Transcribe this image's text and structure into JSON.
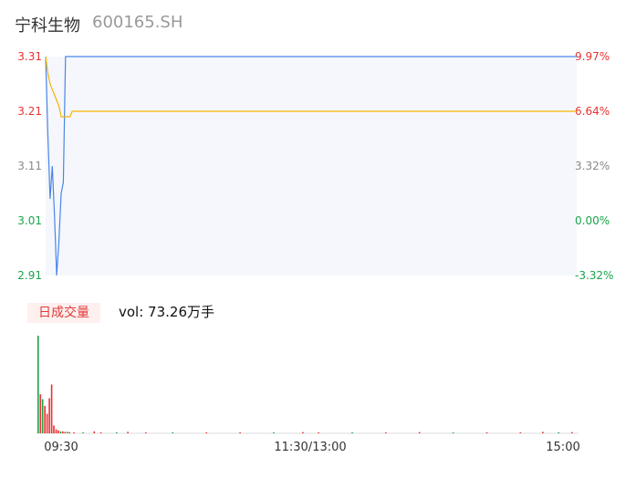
{
  "header": {
    "name": "宁科生物",
    "code": "600165.SH"
  },
  "volume": {
    "tab_label": "日成交量",
    "vol_text": "vol: 73.26万手"
  },
  "colors": {
    "up": "#e83232",
    "down": "#1aa34a",
    "neutral": "#888888",
    "price_line": "#4a86e8",
    "avg_line": "#f5b400",
    "plot_bg": "#f5f7fc"
  },
  "chart_data": {
    "type": "line",
    "title": "",
    "y_left_ticks": [
      "3.31",
      "3.21",
      "3.11",
      "3.01",
      "2.91"
    ],
    "y_right_ticks": [
      "9.97%",
      "6.64%",
      "3.32%",
      "0.00%",
      "-3.32%"
    ],
    "x_ticks": [
      "09:30",
      "11:30/13:00",
      "15:00"
    ],
    "ylim": [
      2.91,
      3.31
    ],
    "prev_close": 3.01,
    "total_minutes": 240,
    "series": [
      {
        "key": "price",
        "points": [
          [
            0,
            3.31
          ],
          [
            1,
            3.17
          ],
          [
            2,
            3.05
          ],
          [
            3,
            3.11
          ],
          [
            4,
            3.02
          ],
          [
            5,
            2.91
          ],
          [
            6,
            2.97
          ],
          [
            7,
            3.06
          ],
          [
            8,
            3.08
          ],
          [
            9,
            3.31
          ],
          [
            240,
            3.31
          ]
        ]
      },
      {
        "key": "avg",
        "points": [
          [
            0,
            3.31
          ],
          [
            1,
            3.28
          ],
          [
            2,
            3.26
          ],
          [
            3,
            3.25
          ],
          [
            4,
            3.24
          ],
          [
            5,
            3.23
          ],
          [
            6,
            3.22
          ],
          [
            7,
            3.2
          ],
          [
            8,
            3.2
          ],
          [
            10,
            3.2
          ],
          [
            11,
            3.2
          ],
          [
            12,
            3.21
          ],
          [
            240,
            3.21
          ]
        ]
      }
    ],
    "volume_bars": [
      {
        "t": 0,
        "v": 1.0,
        "c": "down"
      },
      {
        "t": 1,
        "v": 0.4,
        "c": "up"
      },
      {
        "t": 2,
        "v": 0.35,
        "c": "down"
      },
      {
        "t": 3,
        "v": 0.28,
        "c": "up"
      },
      {
        "t": 4,
        "v": 0.2,
        "c": "up"
      },
      {
        "t": 5,
        "v": 0.36,
        "c": "up"
      },
      {
        "t": 6,
        "v": 0.5,
        "c": "up"
      },
      {
        "t": 7,
        "v": 0.08,
        "c": "up"
      },
      {
        "t": 8,
        "v": 0.04,
        "c": "up"
      },
      {
        "t": 9,
        "v": 0.03,
        "c": "up"
      },
      {
        "t": 10,
        "v": 0.02,
        "c": "down"
      },
      {
        "t": 11,
        "v": 0.02,
        "c": "up"
      },
      {
        "t": 12,
        "v": 0.015,
        "c": "up"
      },
      {
        "t": 13,
        "v": 0.015,
        "c": "down"
      },
      {
        "t": 14,
        "v": 0.012,
        "c": "up"
      },
      {
        "t": 16,
        "v": 0.01,
        "c": "up"
      },
      {
        "t": 20,
        "v": 0.01,
        "c": "down"
      },
      {
        "t": 25,
        "v": 0.02,
        "c": "up"
      },
      {
        "t": 28,
        "v": 0.01,
        "c": "up"
      },
      {
        "t": 35,
        "v": 0.01,
        "c": "down"
      },
      {
        "t": 40,
        "v": 0.015,
        "c": "up"
      },
      {
        "t": 48,
        "v": 0.01,
        "c": "up"
      },
      {
        "t": 60,
        "v": 0.01,
        "c": "down"
      },
      {
        "t": 75,
        "v": 0.01,
        "c": "up"
      },
      {
        "t": 90,
        "v": 0.01,
        "c": "up"
      },
      {
        "t": 105,
        "v": 0.01,
        "c": "down"
      },
      {
        "t": 118,
        "v": 0.012,
        "c": "up"
      },
      {
        "t": 125,
        "v": 0.01,
        "c": "up"
      },
      {
        "t": 140,
        "v": 0.01,
        "c": "down"
      },
      {
        "t": 155,
        "v": 0.01,
        "c": "up"
      },
      {
        "t": 170,
        "v": 0.012,
        "c": "up"
      },
      {
        "t": 185,
        "v": 0.01,
        "c": "down"
      },
      {
        "t": 200,
        "v": 0.01,
        "c": "up"
      },
      {
        "t": 215,
        "v": 0.01,
        "c": "up"
      },
      {
        "t": 225,
        "v": 0.015,
        "c": "up"
      },
      {
        "t": 232,
        "v": 0.01,
        "c": "down"
      },
      {
        "t": 238,
        "v": 0.012,
        "c": "up"
      }
    ]
  }
}
